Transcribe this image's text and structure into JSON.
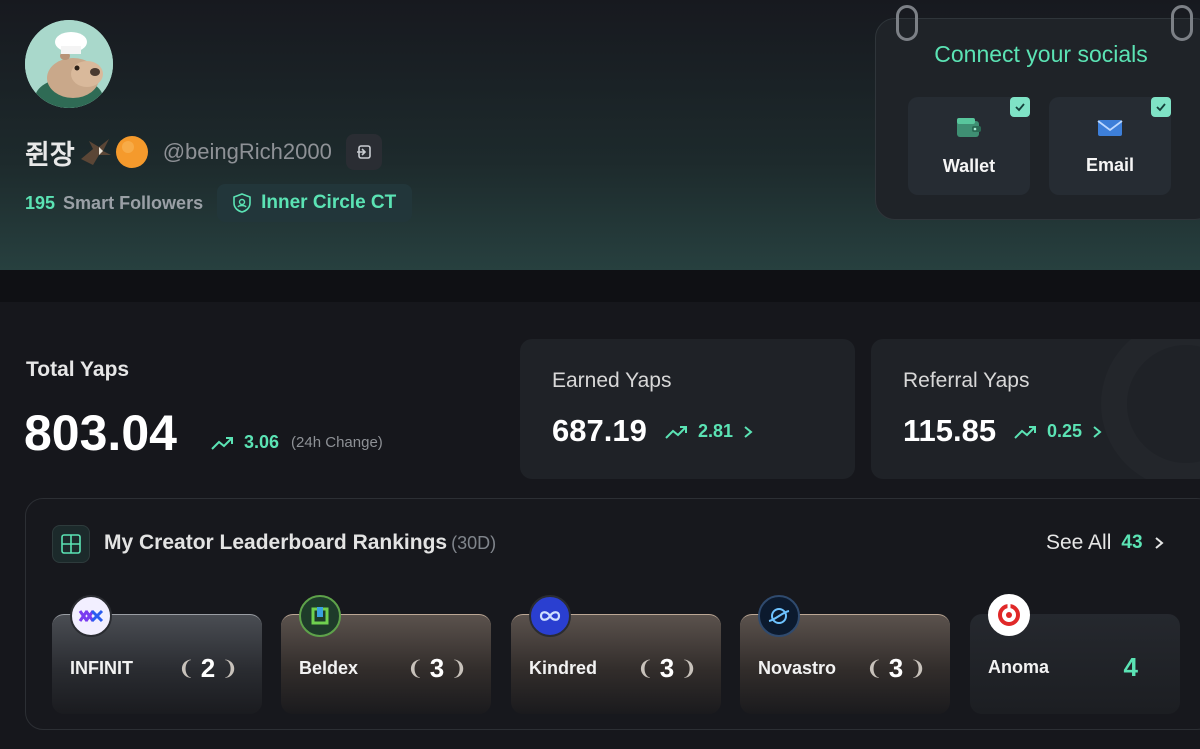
{
  "profile": {
    "display_name": "쥔장",
    "handle": "@beingRich2000",
    "followers_count": "195",
    "followers_label": "Smart Followers",
    "badge_label": "Inner Circle CT"
  },
  "socials": {
    "title": "Connect your socials",
    "items": [
      {
        "label": "Wallet",
        "icon": "wallet-icon",
        "connected": true
      },
      {
        "label": "Email",
        "icon": "email-icon",
        "connected": true
      }
    ]
  },
  "stats": {
    "total": {
      "label": "Total Yaps",
      "value": "803.04",
      "change": "3.06",
      "change_note": "(24h Change)"
    },
    "earned": {
      "label": "Earned Yaps",
      "value": "687.19",
      "change": "2.81"
    },
    "referral": {
      "label": "Referral Yaps",
      "value": "115.85",
      "change": "0.25"
    }
  },
  "leaderboard": {
    "title": "My Creator Leaderboard Rankings",
    "period": "(30D)",
    "see_all_label": "See All",
    "see_all_count": "43",
    "items": [
      {
        "name": "INFINIT",
        "rank": "2",
        "tier": "silver"
      },
      {
        "name": "Beldex",
        "rank": "3",
        "tier": "bronze"
      },
      {
        "name": "Kindred",
        "rank": "3",
        "tier": "bronze"
      },
      {
        "name": "Novastro",
        "rank": "3",
        "tier": "bronze"
      },
      {
        "name": "Anoma",
        "rank": "4",
        "tier": "none"
      }
    ]
  },
  "colors": {
    "accent": "#5be3b4",
    "background": "#16171c",
    "card": "#1f2227"
  }
}
